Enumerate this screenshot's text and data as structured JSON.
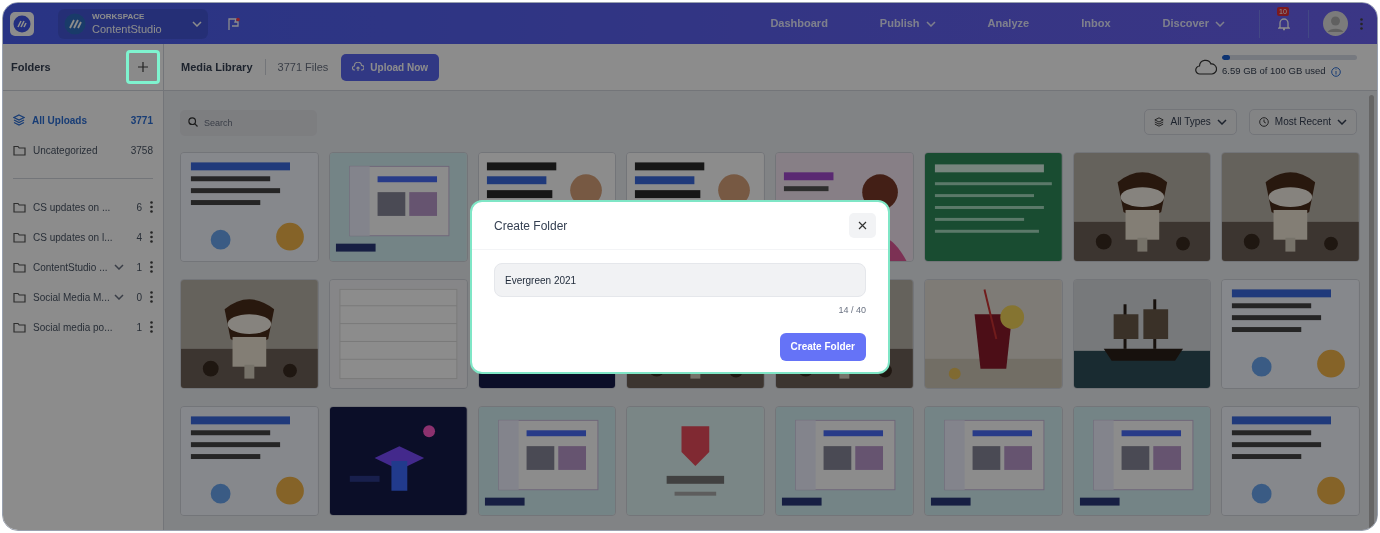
{
  "header": {
    "workspace_label": "WORKSPACE",
    "workspace_name": "ContentStudio",
    "nav": [
      {
        "label": "Dashboard",
        "dropdown": false
      },
      {
        "label": "Publish",
        "dropdown": true
      },
      {
        "label": "Analyze",
        "dropdown": false
      },
      {
        "label": "Inbox",
        "dropdown": false
      },
      {
        "label": "Discover",
        "dropdown": true
      }
    ],
    "notification_count": "10"
  },
  "sidebar": {
    "title": "Folders",
    "items": [
      {
        "kind": "system",
        "label": "All Uploads",
        "count": "3771",
        "selected": true
      },
      {
        "kind": "system",
        "label": "Uncategorized",
        "count": "3758",
        "selected": false
      },
      {
        "kind": "folder",
        "label": "CS updates on ...",
        "count": "6",
        "selected": false
      },
      {
        "kind": "folder",
        "label": "CS updates on l...",
        "count": "4",
        "selected": false
      },
      {
        "kind": "folder",
        "label": "ContentStudio ...",
        "count": "1",
        "selected": false,
        "expanded": false
      },
      {
        "kind": "folder",
        "label": "Social Media M...",
        "count": "0",
        "selected": false,
        "expanded": false
      },
      {
        "kind": "folder",
        "label": "Social media po...",
        "count": "1",
        "selected": false
      }
    ]
  },
  "library": {
    "title": "Media Library",
    "file_count": "3771 Files",
    "upload_button": "Upload Now",
    "storage": {
      "text": "6.59 GB of 100 GB used",
      "level": 0.06
    },
    "search": {
      "placeholder": "Search"
    },
    "filters": [
      "All Types",
      "Most Recent"
    ]
  },
  "dialog": {
    "title": "Create Folder",
    "value": "Evergreen 2021",
    "counter": "14 / 40",
    "button": "Create Folder"
  }
}
